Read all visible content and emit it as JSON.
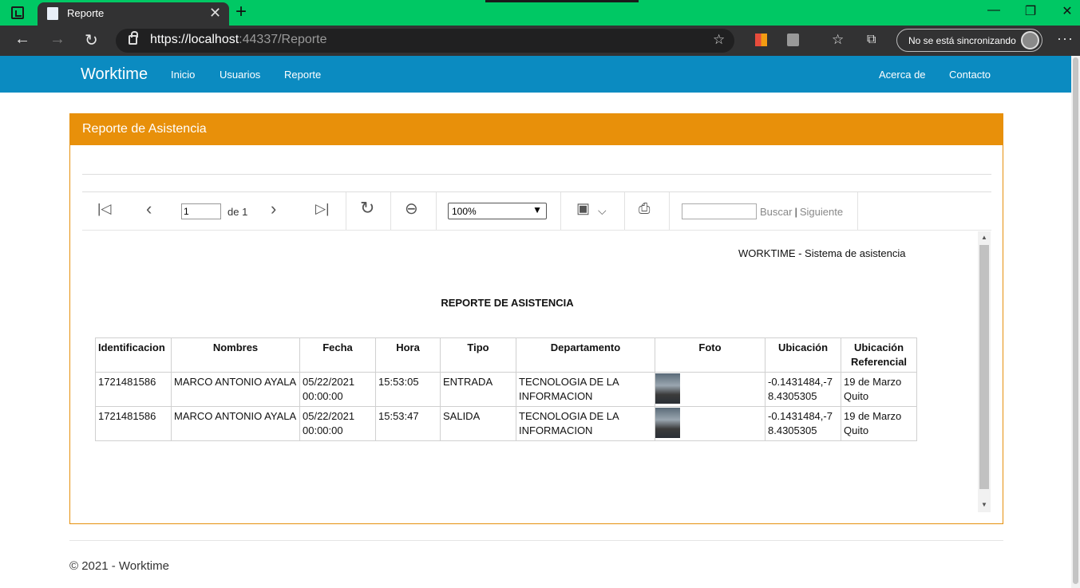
{
  "browser": {
    "tab_title": "Reporte",
    "url_host": "https://localhost",
    "url_rest": ":44337/Reporte",
    "sync_label": "No se está sincronizando",
    "icons": [
      "tab-actions-icon",
      "page-icon",
      "close-icon",
      "plus-icon",
      "back-icon",
      "forward-icon",
      "refresh-icon",
      "lock-icon",
      "favorite-add-icon",
      "extension-icon",
      "favorites-icon",
      "collections-icon",
      "avatar-icon",
      "more-icon"
    ]
  },
  "navbar": {
    "brand": "Worktime",
    "links": [
      "Inicio",
      "Usuarios",
      "Reporte"
    ],
    "right_links": [
      "Acerca de",
      "Contacto"
    ],
    "color": "#0b8bc1"
  },
  "panel": {
    "title": "Reporte de Asistencia",
    "color": "#e8900a"
  },
  "toolbar": {
    "page_value": "1",
    "page_of": "de 1",
    "zoom": "100%",
    "find_label": "Buscar",
    "next_label": "Siguiente"
  },
  "report": {
    "company": "WORKTIME - Sistema de asistencia",
    "title": "REPORTE DE ASISTENCIA",
    "columns": [
      "Identificacion",
      "Nombres",
      "Fecha",
      "Hora",
      "Tipo",
      "Departamento",
      "Foto",
      "Ubicación",
      "Ubicación Referencial"
    ],
    "rows": [
      {
        "id": "1721481586",
        "nombres": "MARCO ANTONIO AYALA",
        "fecha": "05/22/2021 00:00:00",
        "hora": "15:53:05",
        "tipo": "ENTRADA",
        "departamento": "TECNOLOGIA DE LA INFORMACION",
        "ubicacion": "-0.1431484,-78.4305305",
        "referencial": "19 de Marzo Quito"
      },
      {
        "id": "1721481586",
        "nombres": "MARCO ANTONIO AYALA",
        "fecha": "05/22/2021 00:00:00",
        "hora": "15:53:47",
        "tipo": "SALIDA",
        "departamento": "TECNOLOGIA DE LA INFORMACION",
        "ubicacion": "-0.1431484,-78.4305305",
        "referencial": "19 de Marzo Quito"
      }
    ]
  },
  "footer": {
    "text": "© 2021 - Worktime"
  }
}
